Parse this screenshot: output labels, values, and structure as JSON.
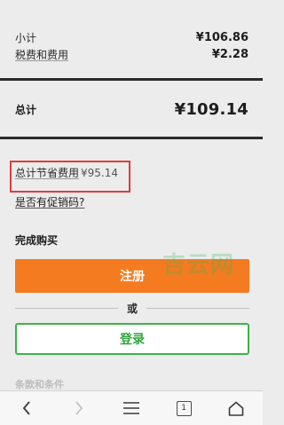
{
  "summary": {
    "subtotal_label": "小计",
    "subtotal_value": "¥106.86",
    "tax_label": "税费和费用",
    "tax_value": "¥2.28",
    "total_label": "总计",
    "total_value": "¥109.14",
    "savings_label": "总计节省费用",
    "savings_value": "¥95.14"
  },
  "promo": {
    "link_label": "是否有促销码?",
    "highlight_color": "#e23b3b"
  },
  "checkout": {
    "heading": "完成购买",
    "register_label": "注册",
    "or_label": "或",
    "login_label": "登录",
    "terms_label": "条款和条件"
  },
  "watermark": {
    "text": "吉云网"
  },
  "browser_nav": {
    "tab_count": "1",
    "icons": [
      "back-arrow-icon",
      "forward-arrow-icon",
      "menu-icon",
      "tabs-icon",
      "home-icon"
    ]
  },
  "colors": {
    "accent_orange": "#f47b20",
    "accent_green": "#3db24a",
    "background": "#ececec"
  }
}
